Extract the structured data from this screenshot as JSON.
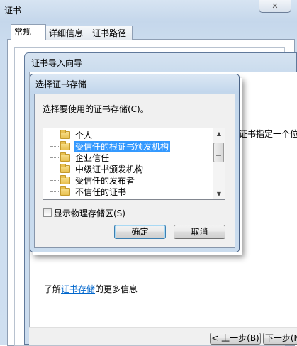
{
  "cert_window": {
    "title": "证书",
    "close_glyph": "✕",
    "tabs": [
      {
        "label": "常规"
      },
      {
        "label": "详细信息"
      },
      {
        "label": "证书路径"
      }
    ]
  },
  "wizard": {
    "title": "证书导入向导",
    "partial_text": "证书指定一个位",
    "learn_prefix": "了解",
    "learn_link": "证书存储",
    "learn_suffix": "的更多信息",
    "back_button": "< 上一步(B)",
    "next_button": "下一步(N)"
  },
  "store_dialog": {
    "title": "选择证书存储",
    "prompt": "选择要使用的证书存储(C)。",
    "stores": [
      {
        "label": "个人",
        "selected": false
      },
      {
        "label": "受信任的根证书颁发机构",
        "selected": true
      },
      {
        "label": "企业信任",
        "selected": false
      },
      {
        "label": "中级证书颁发机构",
        "selected": false
      },
      {
        "label": "受信任的发布者",
        "selected": false
      },
      {
        "label": "不信任的证书",
        "selected": false
      }
    ],
    "show_physical_label": "显示物理存储区(S)",
    "show_physical_checked": false,
    "ok_button": "确定",
    "cancel_button": "取消",
    "scroll_up_glyph": "▲",
    "scroll_down_glyph": "▼"
  },
  "colors": {
    "selection": "#3399ff",
    "link": "#0066cc",
    "frame": "#c9dbed"
  }
}
